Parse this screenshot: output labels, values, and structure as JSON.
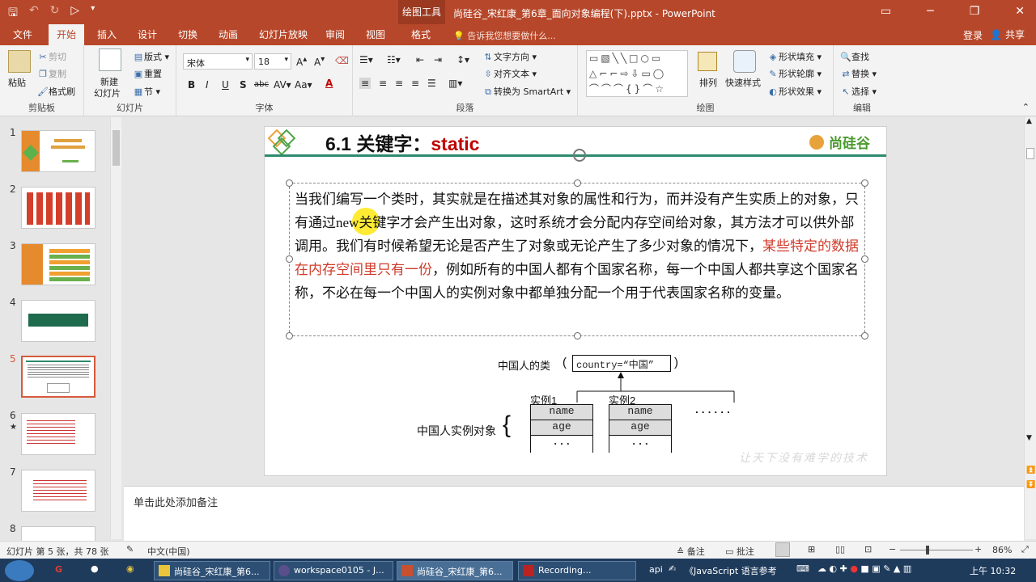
{
  "titlebar": {
    "context_tab": "绘图工具",
    "doc_title": "尚硅谷_宋红康_第6章_面向对象编程(下).pptx - PowerPoint"
  },
  "tabs": {
    "file": "文件",
    "home": "开始",
    "insert": "插入",
    "design": "设计",
    "transitions": "切换",
    "animations": "动画",
    "slideshow": "幻灯片放映",
    "review": "审阅",
    "view": "视图",
    "format": "格式",
    "tell_me": "告诉我您想要做什么...",
    "login": "登录",
    "share": "共享"
  },
  "ribbon": {
    "clipboard": {
      "paste": "粘贴",
      "cut": "剪切",
      "copy": "复制",
      "format_painter": "格式刷",
      "label": "剪贴板"
    },
    "slides": {
      "new_slide": "新建",
      "new_slide2": "幻灯片",
      "layout": "版式",
      "reset": "重置",
      "section": "节",
      "label": "幻灯片"
    },
    "font": {
      "name": "宋体",
      "size": "18",
      "label": "字体"
    },
    "paragraph": {
      "text_direction": "文字方向",
      "align_text": "对齐文本",
      "smartart": "转换为 SmartArt",
      "label": "段落"
    },
    "drawing": {
      "arrange": "排列",
      "quick_styles": "快速样式",
      "fill": "形状填充",
      "outline": "形状轮廓",
      "effects": "形状效果",
      "label": "绘图"
    },
    "editing": {
      "find": "查找",
      "replace": "替换",
      "select": "选择",
      "label": "编辑"
    }
  },
  "thumbnails": {
    "numbers": [
      "1",
      "2",
      "3",
      "4",
      "5",
      "6",
      "7",
      "8"
    ],
    "selected": "5",
    "star": "★"
  },
  "slide": {
    "title_prefix": "6.1  关键字：",
    "title_keyword": "static",
    "logo": "尚硅谷",
    "body_1": "当我们编写一个类时，其实就是在描述其对象的属性和行为，而并没有产生实质上的对象，只有通过new关键字才会产生出对象，这时系统才会分配内存空间给对象，其方法才可以供外部调用。我们有时候希望无论是否产生了对象或无论产生了多少对象的情况下，",
    "body_red": "某些特定的数据在内存空间里只有一份",
    "body_2": "，例如所有的中国人都有个国家名称，每一个中国人都共享这个国家名称，不必在每一个中国人的实例对象中都单独分配一个用于代表国家名称的变量。",
    "diagram": {
      "class_label": "中国人的类",
      "class_field": "country=“中国”",
      "instance1": "实例1",
      "instance2": "实例2",
      "instances_label": "中国人实例对象",
      "field_name": "name",
      "field_age": "age",
      "ellipsis": "...",
      "more": "......"
    },
    "watermark": "让天下没有难学的技术"
  },
  "notes": {
    "placeholder": "单击此处添加备注"
  },
  "statusbar": {
    "slide_info": "幻灯片 第 5 张，共 78 张",
    "language": "中文(中国)",
    "notes": "备注",
    "comments": "批注",
    "zoom": "86%"
  },
  "taskbar": {
    "items": [
      "尚硅谷_宋红康_第6...",
      "workspace0105 - J...",
      "尚硅谷_宋红康_第6...",
      "Recording..."
    ],
    "api": "api",
    "javascript": "《JavaScript 语言参考",
    "clock": "上午 10:32"
  },
  "colors": {
    "accent": "#b7472a",
    "slide_line": "#2e8a6e",
    "red_text": "#c00000"
  }
}
